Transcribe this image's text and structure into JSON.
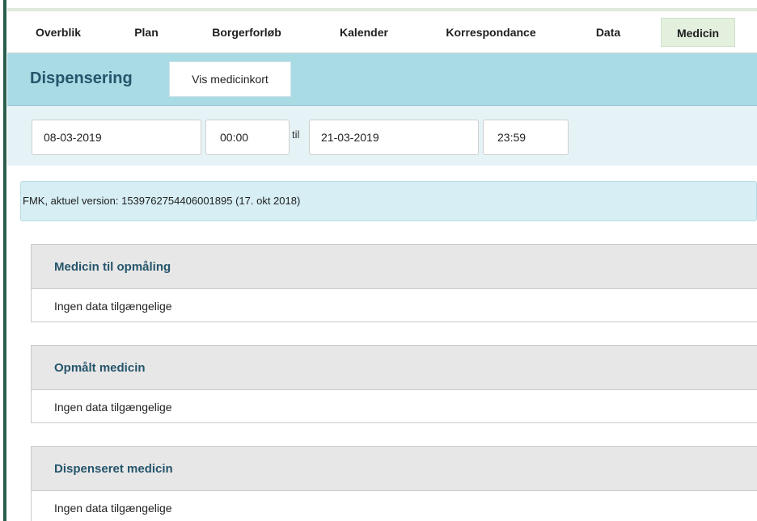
{
  "nav": {
    "tabs": [
      {
        "label": "Overblik"
      },
      {
        "label": "Plan"
      },
      {
        "label": "Borgerforløb"
      },
      {
        "label": "Kalender"
      },
      {
        "label": "Korrespondance"
      },
      {
        "label": "Data"
      },
      {
        "label": "Medicin",
        "active": true
      }
    ]
  },
  "header": {
    "title": "Dispensering",
    "show_card_button": "Vis medicinkort"
  },
  "date_range": {
    "from_date": "08-03-2019",
    "from_time": "00:00",
    "separator": "til",
    "to_date": "21-03-2019",
    "to_time": "23:59"
  },
  "fmk_banner": "FMK, aktuel version: 1539762754406001895 (17. okt 2018)",
  "panels": [
    {
      "title": "Medicin til opmåling",
      "empty_text": "Ingen data tilgængelige"
    },
    {
      "title": "Opmålt medicin",
      "empty_text": "Ingen data tilgængelige"
    },
    {
      "title": "Dispenseret medicin",
      "empty_text": "Ingen data tilgængelige"
    }
  ],
  "colors": {
    "accent_teal": "#a9dbe5",
    "title_text": "#25556b",
    "active_tab": "#e3f0de",
    "sidebar": "#2a5d4c"
  }
}
